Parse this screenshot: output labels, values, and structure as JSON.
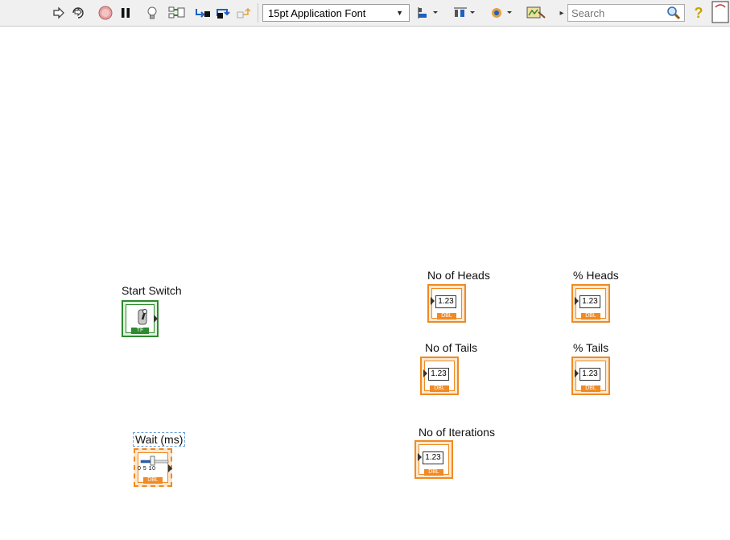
{
  "toolbar": {
    "font_selector": "15pt Application Font",
    "search_placeholder": "Search",
    "icons": [
      "run-arrow-icon",
      "run-continuously-icon",
      "abort-icon",
      "pause-icon",
      "highlight-execution-icon",
      "retain-wire-values-icon",
      "step-into-icon",
      "step-over-icon",
      "step-out-icon",
      "align-objects-icon",
      "distribute-objects-icon",
      "reorder-icon",
      "cleanup-diagram-icon",
      "search-icon",
      "help-icon"
    ]
  },
  "colors": {
    "numeric_terminal": "#f08a22",
    "boolean_terminal": "#2e8a2e",
    "selection": "#6aa0d8"
  },
  "controls": {
    "start_switch": {
      "label": "Start Switch",
      "tag": "TF"
    },
    "wait_ms": {
      "label": "Wait (ms)",
      "tag": "DBL",
      "ticks": "0 5 10"
    }
  },
  "indicators": {
    "no_of_heads": {
      "label": "No of Heads",
      "value": "1.23",
      "tag": "DBL"
    },
    "pct_heads": {
      "label": "% Heads",
      "value": "1.23",
      "tag": "DBL"
    },
    "no_of_tails": {
      "label": "No of Tails",
      "value": "1.23",
      "tag": "DBL"
    },
    "pct_tails": {
      "label": "% Tails",
      "value": "1.23",
      "tag": "DBL"
    },
    "no_of_iterations": {
      "label": "No of Iterations",
      "value": "1.23",
      "tag": "DBL"
    }
  }
}
